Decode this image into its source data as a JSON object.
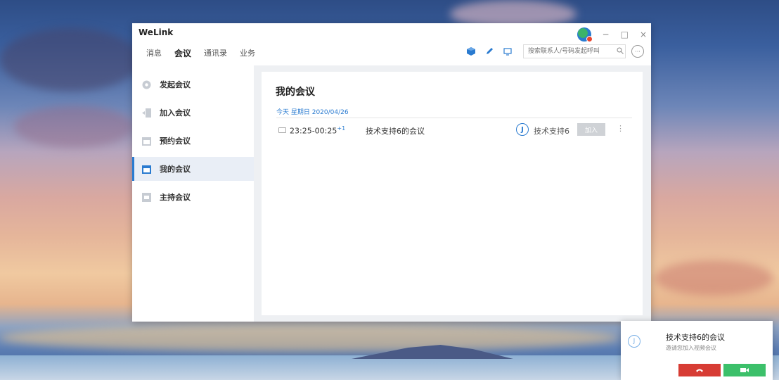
{
  "app": {
    "title": "WeLink"
  },
  "tabs": [
    {
      "label": "消息"
    },
    {
      "label": "会议"
    },
    {
      "label": "通讯录"
    },
    {
      "label": "业务"
    }
  ],
  "search": {
    "placeholder": "搜索联系人/号码发起呼叫"
  },
  "window_controls": {
    "minimize": "−",
    "maximize": "□",
    "close": "×"
  },
  "sidebar": {
    "items": [
      {
        "label": "发起会议",
        "icon": "start-meeting-icon"
      },
      {
        "label": "加入会议",
        "icon": "join-meeting-icon"
      },
      {
        "label": "预约会议",
        "icon": "schedule-meeting-icon"
      },
      {
        "label": "我的会议",
        "icon": "my-meetings-icon"
      },
      {
        "label": "主持会议",
        "icon": "host-meeting-icon"
      }
    ]
  },
  "main": {
    "title": "我的会议",
    "date_label": "今天 星期日 2020/04/26",
    "meetings": [
      {
        "time": "23:25-00:25",
        "time_suffix": "+1",
        "subject": "技术支持6的会议",
        "host_initial": "J",
        "host": "技术支持6",
        "join_label": "加入",
        "more": "⋮"
      }
    ]
  },
  "notification": {
    "avatar_initial": "J",
    "title": "技术支持6的会议",
    "subtitle": "邀请您加入视频会议"
  },
  "colors": {
    "accent": "#2a7bd0",
    "decline": "#d73c34",
    "accept": "#3cc06a"
  }
}
